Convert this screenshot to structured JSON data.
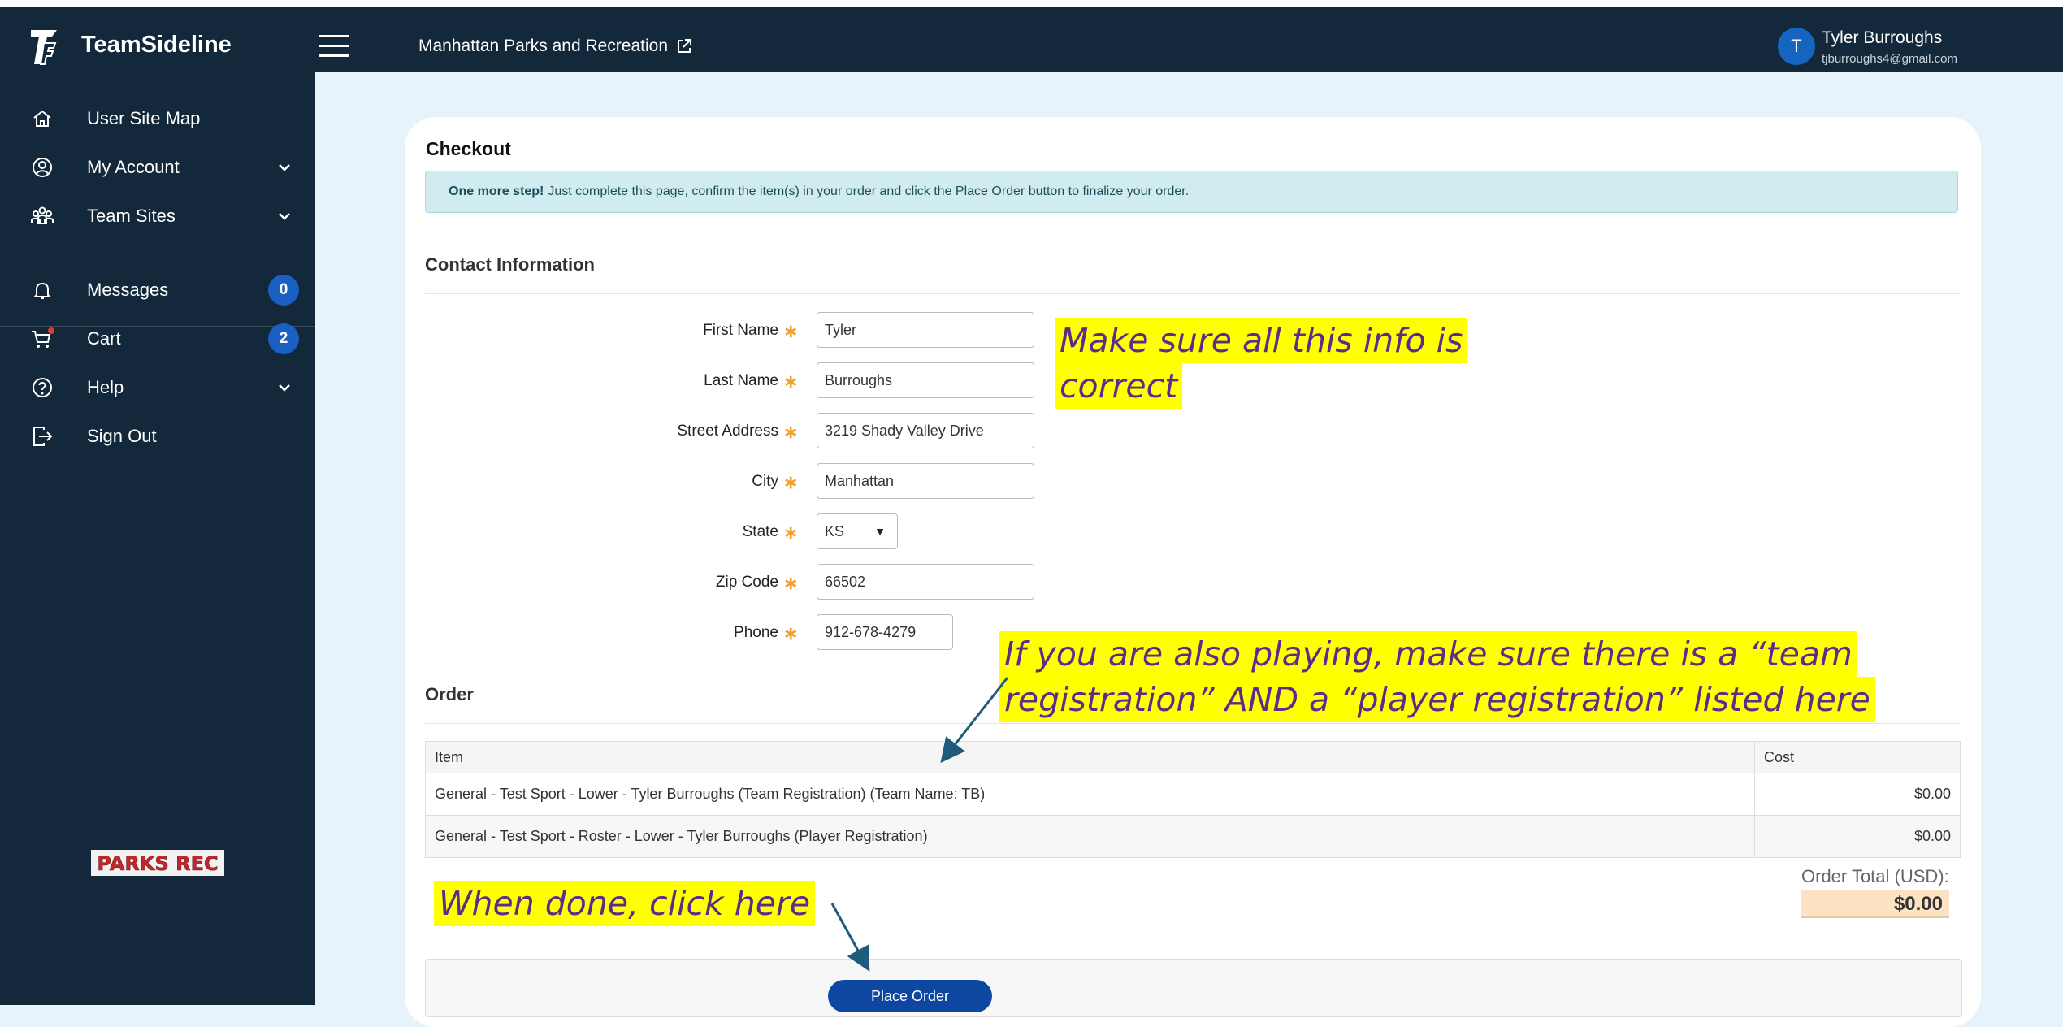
{
  "header": {
    "brand": "TeamSideline",
    "org_name": "Manhattan Parks and Recreation",
    "user_initial": "T",
    "user_name": "Tyler Burroughs",
    "user_email": "tjburroughs4@gmail.com"
  },
  "sidebar": {
    "items": [
      {
        "label": "User Site Map",
        "icon": "home-icon"
      },
      {
        "label": "My Account",
        "icon": "user-circle-icon",
        "has_dropdown": true
      },
      {
        "label": "Team Sites",
        "icon": "team-icon",
        "has_dropdown": true
      },
      {
        "label": "Messages",
        "icon": "bell-icon",
        "badge": "0"
      },
      {
        "label": "Cart",
        "icon": "cart-icon",
        "badge": "2"
      },
      {
        "label": "Help",
        "icon": "help-icon",
        "has_dropdown": true
      },
      {
        "label": "Sign Out",
        "icon": "sign-out-icon"
      }
    ],
    "logo_text": "PARKS REC"
  },
  "checkout": {
    "title": "Checkout",
    "alert_bold": "One more step!",
    "alert_text": "Just complete this page, confirm the item(s) in your order and click the Place Order button to finalize your order.",
    "contact_title": "Contact Information",
    "fields": {
      "first_name": {
        "label": "First Name",
        "value": "Tyler"
      },
      "last_name": {
        "label": "Last Name",
        "value": "Burroughs"
      },
      "street": {
        "label": "Street Address",
        "value": "3219 Shady Valley Drive"
      },
      "city": {
        "label": "City",
        "value": "Manhattan"
      },
      "state": {
        "label": "State",
        "value": "KS"
      },
      "zip": {
        "label": "Zip Code",
        "value": "66502"
      },
      "phone": {
        "label": "Phone",
        "value": "912-678-4279"
      }
    },
    "required_mark": "∗",
    "order_title": "Order",
    "order_table": {
      "headers": [
        "Item",
        "Cost"
      ],
      "rows": [
        {
          "item": "General - Test Sport - Lower - Tyler Burroughs (Team Registration) (Team Name: TB)",
          "cost": "$0.00"
        },
        {
          "item": "General - Test Sport - Roster - Lower - Tyler Burroughs (Player Registration)",
          "cost": "$0.00"
        }
      ]
    },
    "total_label": "Order Total (USD):",
    "total_value": "$0.00",
    "place_order_label": "Place Order"
  },
  "annotations": {
    "info_note_line1": "Make sure all this info is",
    "info_note_line2": "correct",
    "order_note_line1": "If you are also playing, make sure there is a “team",
    "order_note_line2": "registration” AND a “player registration” listed here",
    "done_note": "When done, click here"
  },
  "colors": {
    "nav_bg": "#13283a",
    "page_bg": "#e7f3fb",
    "highlight": "#ffff00",
    "annotation_text": "#5b2d8a",
    "button": "#0d47a1"
  }
}
